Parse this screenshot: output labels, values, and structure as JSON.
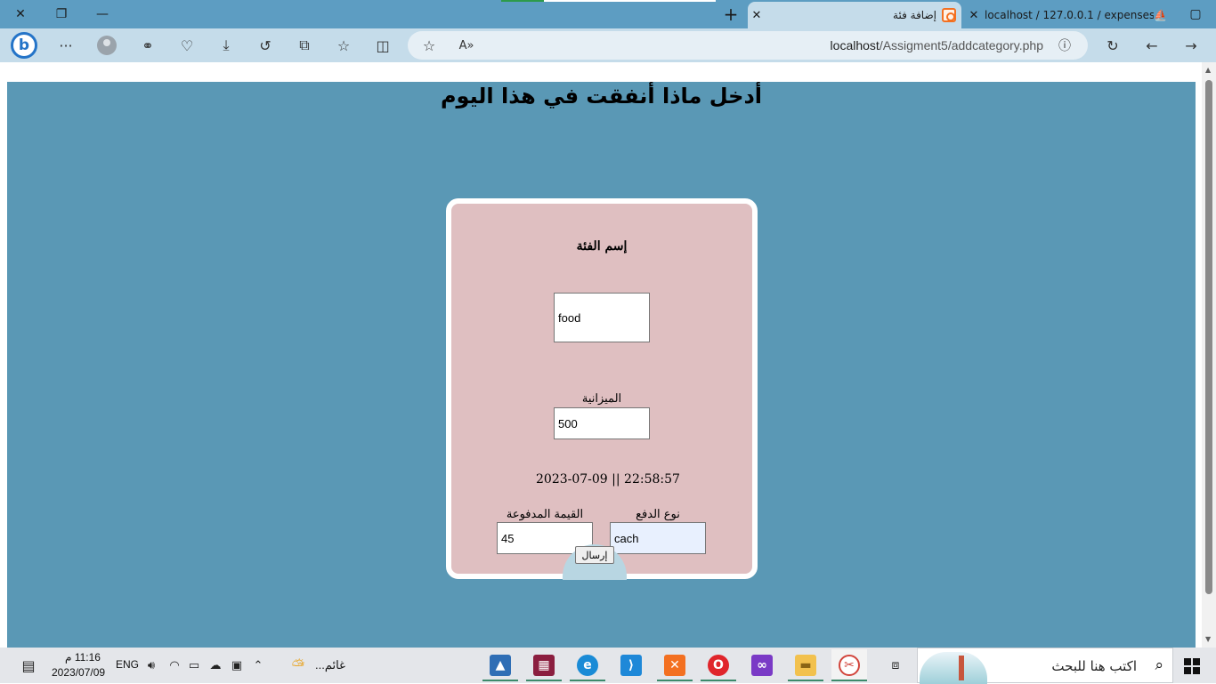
{
  "browser": {
    "tabs": [
      {
        "title": "إضافة فئة",
        "active": true
      },
      {
        "title": "localhost / 127.0.0.1 / expenses t",
        "active": false
      }
    ],
    "address": {
      "host": "localhost",
      "path": "/Assigment5/addcategory.php"
    }
  },
  "page": {
    "heading": "أدخل ماذا أنفقت في هذا اليوم",
    "form": {
      "category_label": "إسم الفئة",
      "category_value": "food",
      "budget_label": "الميزانية",
      "budget_value": "500",
      "datetime": "2023-07-09 || 22:58:57",
      "paid_label": "القيمة المدفوعة",
      "paid_value": "45",
      "payment_type_label": "نوع الدفع",
      "payment_type_value": "cach",
      "submit_label": "إرسال"
    }
  },
  "taskbar": {
    "search_placeholder": "اكتب هنا للبحث",
    "weather": "غائم...",
    "language": "ENG",
    "time": "11:16 م",
    "date": "2023/07/09"
  },
  "colors": {
    "page_bg": "#5a98b5",
    "card_bg": "#dfbfc1",
    "chrome": "#5d9dc2",
    "toolbar": "#c5dcea"
  }
}
